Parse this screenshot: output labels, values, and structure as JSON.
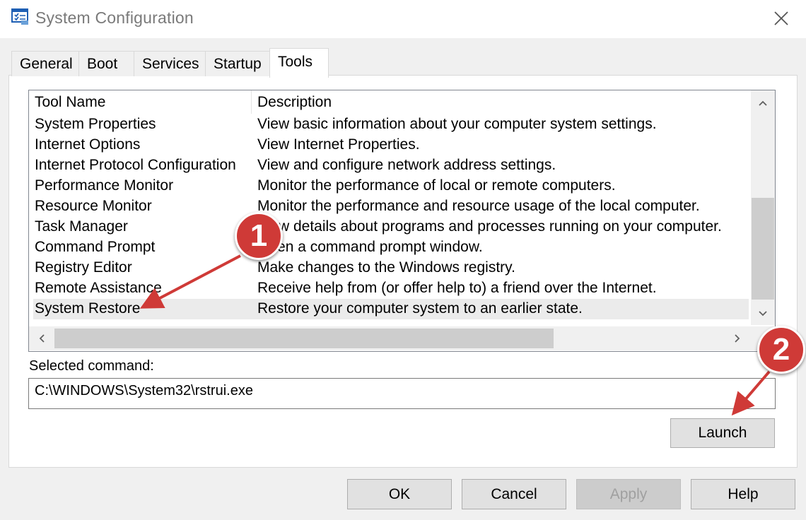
{
  "window": {
    "title": "System Configuration",
    "icon": "msconfig-icon",
    "close_glyph": "✕"
  },
  "tabs": [
    {
      "label": "General"
    },
    {
      "label": "Boot"
    },
    {
      "label": "Services"
    },
    {
      "label": "Startup"
    },
    {
      "label": "Tools",
      "active": true
    }
  ],
  "list": {
    "columns": [
      "Tool Name",
      "Description"
    ],
    "rows": [
      {
        "name": "System Properties",
        "description": "View basic information about your computer system settings."
      },
      {
        "name": "Internet Options",
        "description": "View Internet Properties."
      },
      {
        "name": "Internet Protocol Configuration",
        "description": "View and configure network address settings."
      },
      {
        "name": "Performance Monitor",
        "description": "Monitor the performance of local or remote computers."
      },
      {
        "name": "Resource Monitor",
        "description": "Monitor the performance and resource usage of the local computer."
      },
      {
        "name": "Task Manager",
        "description": "View details about programs and processes running on your computer."
      },
      {
        "name": "Command Prompt",
        "description": "Open a command prompt window."
      },
      {
        "name": "Registry Editor",
        "description": "Make changes to the Windows registry."
      },
      {
        "name": "Remote Assistance",
        "description": "Receive help from (or offer help to) a friend over the Internet."
      },
      {
        "name": "System Restore",
        "description": "Restore your computer system to an earlier state.",
        "selected": true
      }
    ]
  },
  "selected_command": {
    "label": "Selected command:",
    "value": "C:\\WINDOWS\\System32\\rstrui.exe"
  },
  "buttons": {
    "launch": "Launch",
    "ok": "OK",
    "cancel": "Cancel",
    "apply": "Apply",
    "help": "Help"
  },
  "annotations": {
    "step1": "1",
    "step2": "2",
    "color": "#cf3a37"
  }
}
